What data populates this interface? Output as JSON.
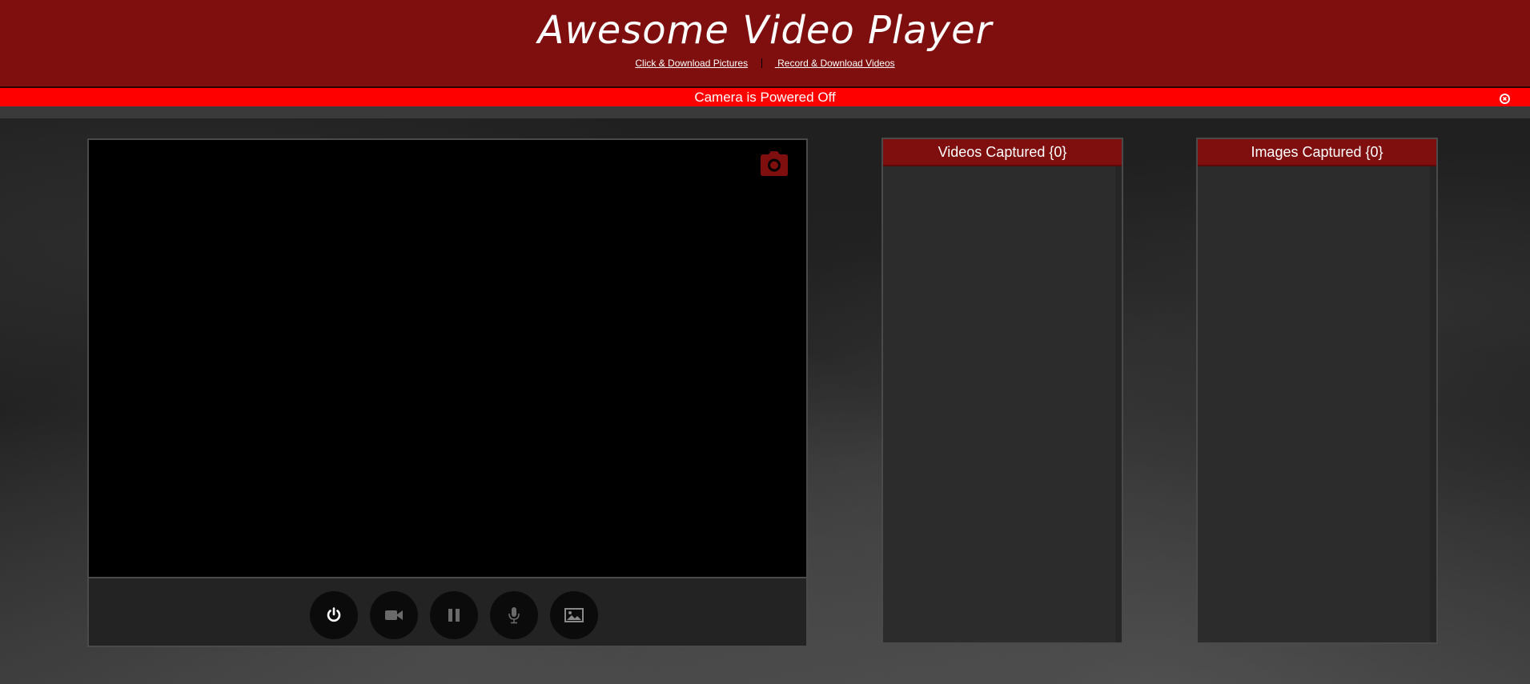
{
  "header": {
    "title": "Awesome Video Player",
    "nav": {
      "pictures_link": "Click & Download Pictures",
      "videos_link": " Record & Download Videos"
    }
  },
  "alert": {
    "message": "Camera is Powered Off",
    "close_icon": "close-circle-icon"
  },
  "player": {
    "snapshot_icon": "camera-icon",
    "controls": [
      {
        "name": "power",
        "icon": "power-icon",
        "color": "#ffffff"
      },
      {
        "name": "record",
        "icon": "video-camera-icon",
        "color": "#6a6a6a"
      },
      {
        "name": "pause",
        "icon": "pause-icon",
        "color": "#6a6a6a"
      },
      {
        "name": "mic",
        "icon": "microphone-icon",
        "color": "#6a6a6a"
      },
      {
        "name": "gallery",
        "icon": "image-icon",
        "color": "#6a6a6a"
      }
    ]
  },
  "panels": {
    "videos": {
      "title": "Videos Captured {0}"
    },
    "images": {
      "title": "Images Captured {0}"
    }
  },
  "colors": {
    "brand": "#7f0f0f",
    "alert": "#ff0000",
    "background": "#1e1e1e"
  }
}
